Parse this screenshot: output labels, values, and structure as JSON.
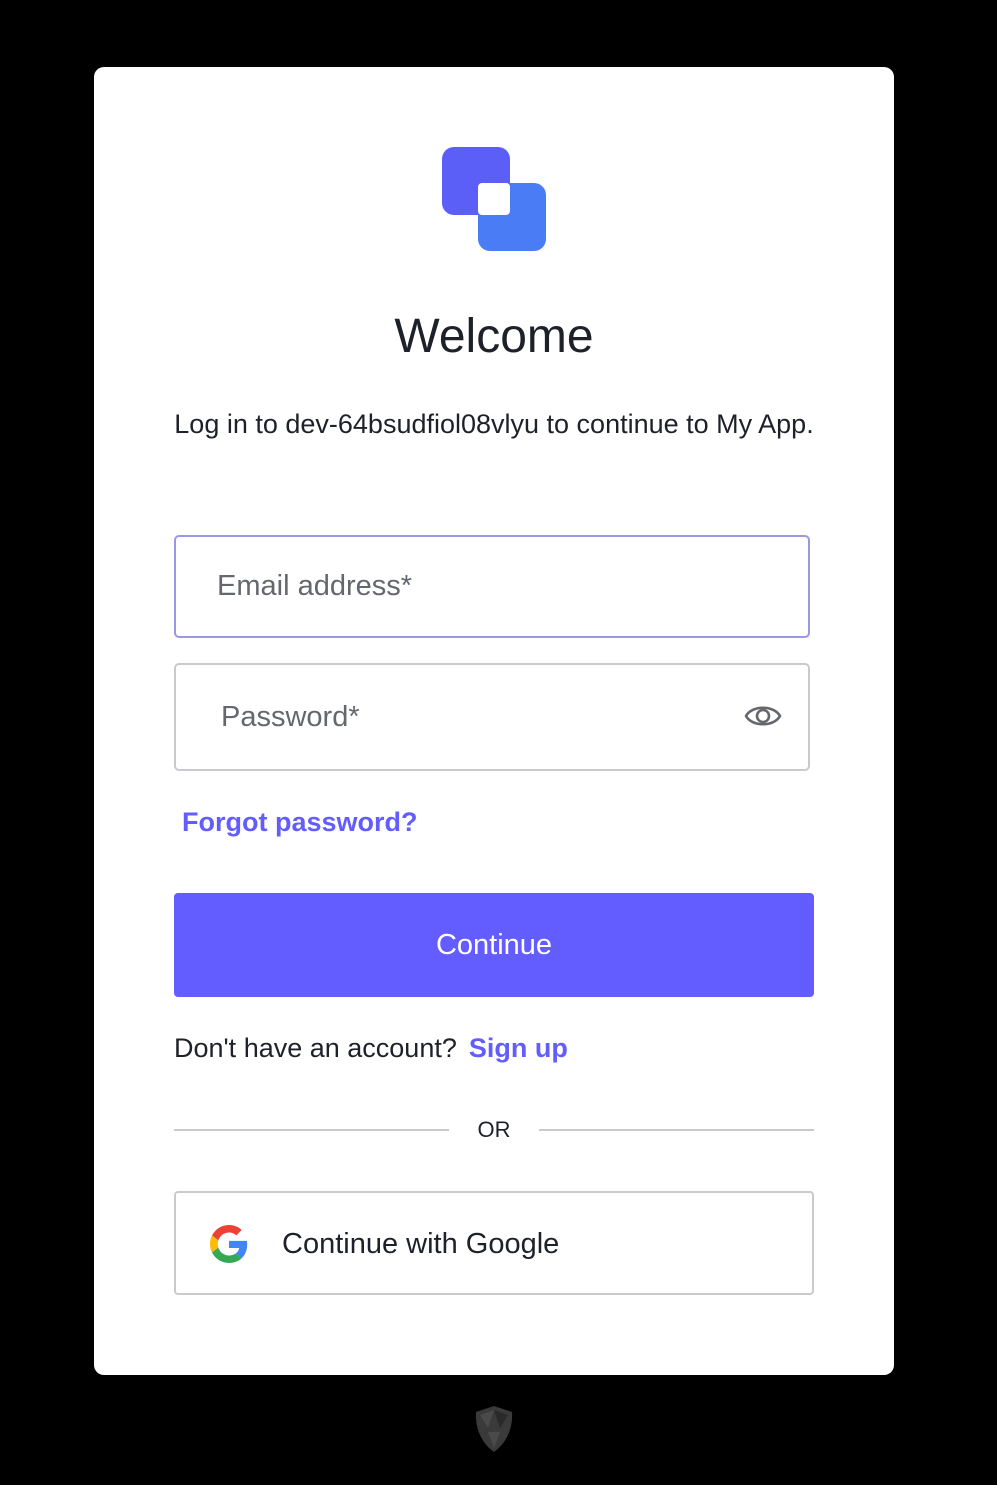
{
  "card": {
    "title": "Welcome",
    "subtitle": "Log in to dev-64bsudfiol08vlyu to continue to My App."
  },
  "logo": {
    "icon": "app-logo-icon"
  },
  "email": {
    "placeholder": "Email address*",
    "value": ""
  },
  "password": {
    "placeholder": "Password*",
    "value": "",
    "toggle_icon": "eye-icon"
  },
  "links": {
    "forgot_password": "Forgot password?",
    "no_account_text": "Don't have an account?",
    "sign_up": "Sign up"
  },
  "buttons": {
    "continue": "Continue",
    "google": "Continue with Google"
  },
  "divider": {
    "text": "OR"
  },
  "footer": {
    "icon": "auth0-shield-icon"
  },
  "colors": {
    "accent": "#635dff",
    "text": "#1e212a",
    "border": "#c9cace",
    "focus_border": "#9c97e5",
    "background": "#000000",
    "card": "#ffffff"
  }
}
